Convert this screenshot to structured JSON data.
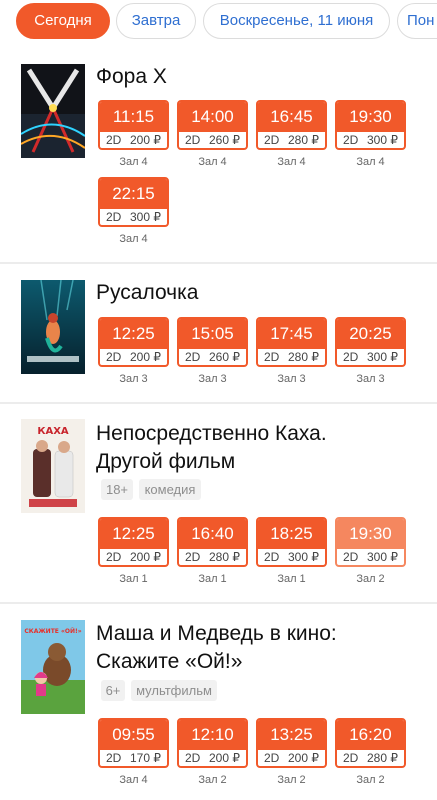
{
  "date_tabs": [
    {
      "label": "Сегодня",
      "active": true
    },
    {
      "label": "Завтра",
      "active": false
    },
    {
      "label": "Воскресенье, 11 июня",
      "active": false
    },
    {
      "label": "Пон",
      "active": false
    }
  ],
  "colors": {
    "accent": "#f1592a",
    "accent_light": "#f5875f",
    "tab_text": "#2f6fd1"
  },
  "movies": [
    {
      "title_lines": [
        "Фора X"
      ],
      "poster_icon": "movie-poster",
      "tags": [],
      "sessions": [
        {
          "time": "11:15",
          "format": "2D",
          "price": "200 ₽",
          "hall": "Зал 4"
        },
        {
          "time": "14:00",
          "format": "2D",
          "price": "260 ₽",
          "hall": "Зал 4"
        },
        {
          "time": "16:45",
          "format": "2D",
          "price": "280 ₽",
          "hall": "Зал 4"
        },
        {
          "time": "19:30",
          "format": "2D",
          "price": "300 ₽",
          "hall": "Зал 4"
        },
        {
          "time": "22:15",
          "format": "2D",
          "price": "300 ₽",
          "hall": "Зал 4"
        }
      ]
    },
    {
      "title_lines": [
        "Русалочка"
      ],
      "poster_icon": "movie-poster",
      "tags": [],
      "sessions": [
        {
          "time": "12:25",
          "format": "2D",
          "price": "200 ₽",
          "hall": "Зал 3"
        },
        {
          "time": "15:05",
          "format": "2D",
          "price": "260 ₽",
          "hall": "Зал 3"
        },
        {
          "time": "17:45",
          "format": "2D",
          "price": "280 ₽",
          "hall": "Зал 3"
        },
        {
          "time": "20:25",
          "format": "2D",
          "price": "300 ₽",
          "hall": "Зал 3"
        }
      ]
    },
    {
      "title_lines": [
        "Непосредственно Каха.",
        "Другой фильм"
      ],
      "poster_icon": "movie-poster",
      "poster_text": "КАХА",
      "tags": [
        "18+",
        "комедия"
      ],
      "sessions": [
        {
          "time": "12:25",
          "format": "2D",
          "price": "200 ₽",
          "hall": "Зал 1"
        },
        {
          "time": "16:40",
          "format": "2D",
          "price": "280 ₽",
          "hall": "Зал 1"
        },
        {
          "time": "18:25",
          "format": "2D",
          "price": "300 ₽",
          "hall": "Зал 1"
        },
        {
          "time": "19:30",
          "format": "2D",
          "price": "300 ₽",
          "hall": "Зал 2",
          "highlight": true
        }
      ]
    },
    {
      "title_lines": [
        "Маша и Медведь в кино:",
        "Скажите «Ой!»"
      ],
      "poster_icon": "movie-poster",
      "poster_text": "СКАЖИТЕ «ОЙ!»",
      "tags": [
        "6+",
        "мультфильм"
      ],
      "sessions": [
        {
          "time": "09:55",
          "format": "2D",
          "price": "170 ₽",
          "hall": "Зал 4"
        },
        {
          "time": "12:10",
          "format": "2D",
          "price": "200 ₽",
          "hall": "Зал 2"
        },
        {
          "time": "13:25",
          "format": "2D",
          "price": "200 ₽",
          "hall": "Зал 2"
        },
        {
          "time": "16:20",
          "format": "2D",
          "price": "280 ₽",
          "hall": "Зал 2"
        }
      ]
    }
  ]
}
